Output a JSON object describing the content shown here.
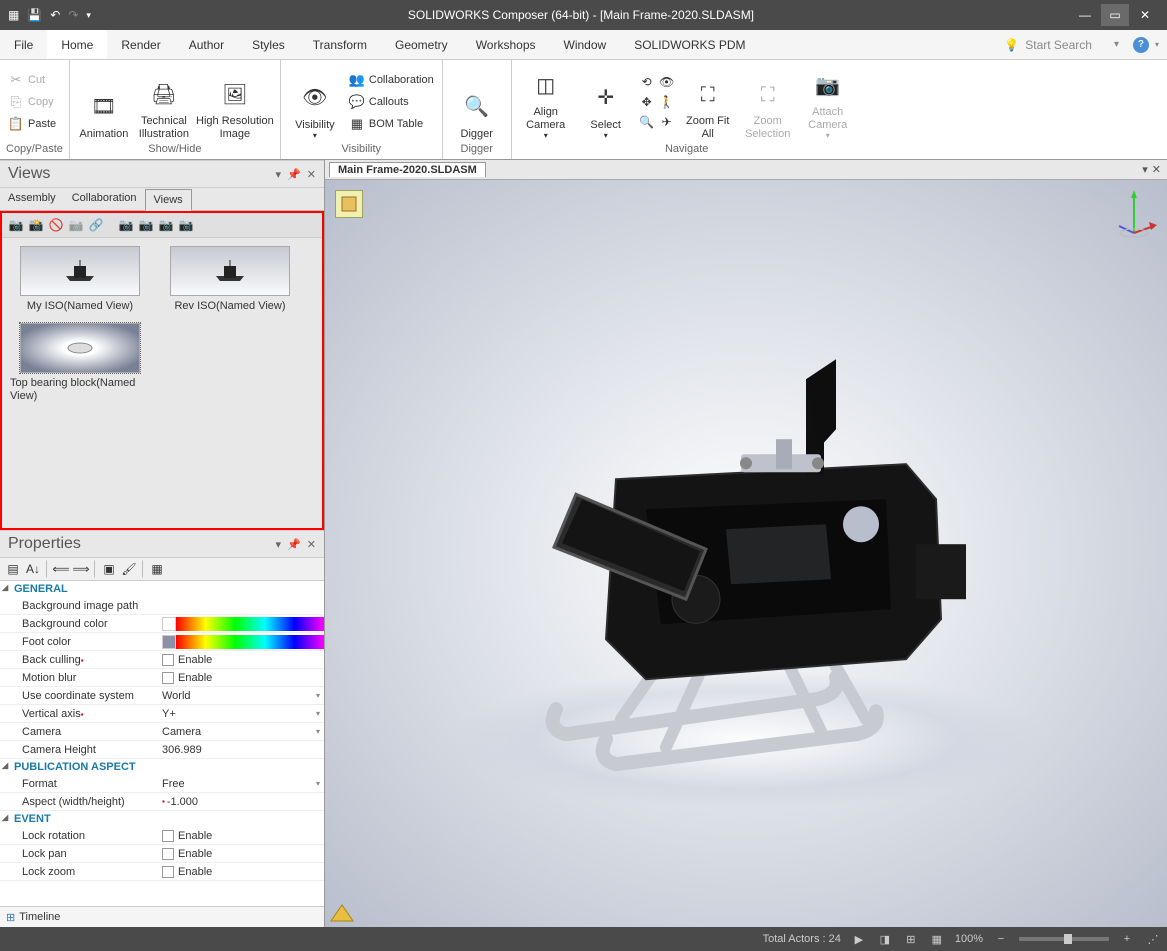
{
  "window": {
    "title": "SOLIDWORKS Composer (64-bit) - [Main Frame-2020.SLDASM]"
  },
  "menu": {
    "items": [
      "File",
      "Home",
      "Render",
      "Author",
      "Styles",
      "Transform",
      "Geometry",
      "Workshops",
      "Window",
      "SOLIDWORKS PDM"
    ],
    "active": "Home",
    "search_placeholder": "Start Search"
  },
  "ribbon": {
    "groups": {
      "copypaste": {
        "label": "Copy/Paste",
        "cut": "Cut",
        "copy": "Copy",
        "paste": "Paste"
      },
      "showhide": {
        "label": "Show/Hide",
        "animation": "Animation",
        "technical": "Technical Illustration",
        "highres": "High Resolution Image"
      },
      "visibility": {
        "label": "Visibility",
        "visibility": "Visibility",
        "collaboration": "Collaboration",
        "callouts": "Callouts",
        "bom": "BOM Table"
      },
      "digger": {
        "label": "Digger",
        "digger": "Digger"
      },
      "navigate": {
        "label": "Navigate",
        "align": "Align Camera",
        "select": "Select",
        "zoomfit": "Zoom Fit All",
        "zoomsel": "Zoom Selection",
        "attach": "Attach Camera"
      }
    }
  },
  "views_panel": {
    "title": "Views",
    "tabs": [
      "Assembly",
      "Collaboration",
      "Views"
    ],
    "active_tab": "Views",
    "items": [
      {
        "label": "My ISO(Named View)"
      },
      {
        "label": "Rev ISO(Named View)"
      },
      {
        "label": "Top bearing block(Named View)"
      }
    ]
  },
  "properties_panel": {
    "title": "Properties",
    "sections": {
      "general": {
        "header": "GENERAL",
        "rows": {
          "bg_image": "Background image path",
          "bg_color": "Background color",
          "foot_color": "Foot color",
          "back_culling": "Back culling",
          "back_culling_v": "Enable",
          "motion_blur": "Motion blur",
          "motion_blur_v": "Enable",
          "coord": "Use coordinate system",
          "coord_v": "World",
          "vaxis": "Vertical axis",
          "vaxis_v": "Y+",
          "camera": "Camera",
          "camera_v": "Camera",
          "camera_h": "Camera Height",
          "camera_h_v": "306.989"
        }
      },
      "publication": {
        "header": "PUBLICATION ASPECT",
        "rows": {
          "format": "Format",
          "format_v": "Free",
          "aspect": "Aspect (width/height)",
          "aspect_v": "-1.000"
        }
      },
      "event": {
        "header": "EVENT",
        "rows": {
          "lockrot": "Lock rotation",
          "lockrot_v": "Enable",
          "lockpan": "Lock pan",
          "lockpan_v": "Enable",
          "lockzoom": "Lock zoom",
          "lockzoom_v": "Enable"
        }
      }
    }
  },
  "viewport": {
    "tab_label": "Main Frame-2020.SLDASM"
  },
  "timeline": {
    "label": "Timeline"
  },
  "status": {
    "actors": "Total Actors : 24",
    "zoom": "100%"
  }
}
